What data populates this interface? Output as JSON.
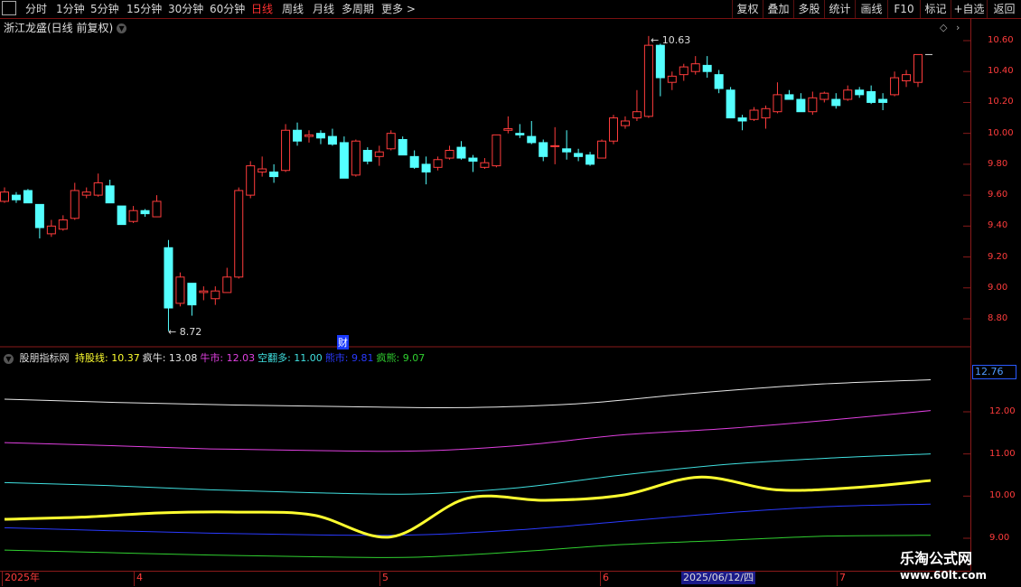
{
  "toolbar": {
    "periods": [
      "分时",
      "1分钟",
      "5分钟",
      "15分钟",
      "30分钟",
      "60分钟",
      "日线",
      "周线",
      "月线",
      "多周期",
      "更多 >"
    ],
    "active_period": "日线",
    "right_buttons": [
      "复权",
      "叠加",
      "多股",
      "统计",
      "画线",
      "F10",
      "标记",
      "+自选",
      "返回"
    ]
  },
  "stock": {
    "title": "浙江龙盛(日线 前复权)"
  },
  "indicator": {
    "name": "股朋指标网",
    "items": [
      {
        "label": "持股线: 10.37",
        "color": "#ffff30"
      },
      {
        "label": "疯牛: 13.08",
        "color": "#e8e8e8"
      },
      {
        "label": "牛市: 12.03",
        "color": "#e040e0"
      },
      {
        "label": "空翻多: 11.00",
        "color": "#40e0e0"
      },
      {
        "label": "熊市: 9.81",
        "color": "#2a3aff"
      },
      {
        "label": "疯熊: 9.07",
        "color": "#30d030"
      }
    ],
    "current_value": "12.76"
  },
  "price_axis": [
    "10.60",
    "10.40",
    "10.20",
    "10.00",
    "9.80",
    "9.60",
    "9.40",
    "9.20",
    "9.00",
    "8.80"
  ],
  "indicator_axis": [
    "12.00",
    "11.00",
    "10.00",
    "9.00"
  ],
  "annotations": {
    "high": "10.63",
    "low": "8.72",
    "marker": "财"
  },
  "x_axis": {
    "labels": [
      "2025年",
      "4",
      "5",
      "6",
      "7"
    ],
    "cursor_date": "2025/06/12/四"
  },
  "watermark": {
    "line1": "乐淘公式网",
    "line2": "www.60lt.com"
  },
  "colors": {
    "up": "#ff3c3c",
    "down": "#54ffff",
    "axis": "#8a1a1a",
    "yellow": "#ffff30"
  },
  "chart_data": {
    "type": "candlestick",
    "ohlc": [
      [
        9.56,
        9.65,
        9.55,
        9.62
      ],
      [
        9.6,
        9.62,
        9.55,
        9.57
      ],
      [
        9.63,
        9.64,
        9.55,
        9.55
      ],
      [
        9.54,
        9.54,
        9.32,
        9.39
      ],
      [
        9.35,
        9.44,
        9.33,
        9.4
      ],
      [
        9.38,
        9.47,
        9.37,
        9.44
      ],
      [
        9.45,
        9.68,
        9.44,
        9.63
      ],
      [
        9.6,
        9.65,
        9.58,
        9.62
      ],
      [
        9.6,
        9.74,
        9.59,
        9.68
      ],
      [
        9.66,
        9.7,
        9.55,
        9.55
      ],
      [
        9.53,
        9.53,
        9.41,
        9.41
      ],
      [
        9.43,
        9.53,
        9.42,
        9.5
      ],
      [
        9.5,
        9.51,
        9.46,
        9.48
      ],
      [
        9.46,
        9.6,
        9.46,
        9.56
      ],
      [
        9.26,
        9.31,
        8.72,
        8.87
      ],
      [
        8.9,
        9.1,
        8.88,
        9.07
      ],
      [
        9.03,
        9.03,
        8.82,
        8.89
      ],
      [
        8.97,
        9.01,
        8.92,
        8.98
      ],
      [
        8.93,
        9.01,
        8.89,
        8.98
      ],
      [
        8.97,
        9.13,
        8.97,
        9.07
      ],
      [
        9.07,
        9.65,
        9.06,
        9.63
      ],
      [
        9.6,
        9.82,
        9.58,
        9.79
      ],
      [
        9.75,
        9.85,
        9.72,
        9.77
      ],
      [
        9.75,
        9.8,
        9.68,
        9.72
      ],
      [
        9.76,
        10.06,
        9.75,
        10.02
      ],
      [
        10.02,
        10.07,
        9.92,
        9.95
      ],
      [
        9.98,
        10.02,
        9.94,
        9.99
      ],
      [
        10.0,
        10.02,
        9.93,
        9.97
      ],
      [
        9.98,
        10.03,
        9.92,
        9.93
      ],
      [
        9.94,
        9.98,
        9.71,
        9.71
      ],
      [
        9.73,
        9.96,
        9.72,
        9.95
      ],
      [
        9.89,
        9.91,
        9.8,
        9.82
      ],
      [
        9.85,
        9.92,
        9.79,
        9.88
      ],
      [
        9.9,
        10.02,
        9.89,
        10.0
      ],
      [
        9.96,
        9.98,
        9.86,
        9.86
      ],
      [
        9.85,
        9.89,
        9.77,
        9.78
      ],
      [
        9.8,
        9.85,
        9.67,
        9.75
      ],
      [
        9.78,
        9.85,
        9.76,
        9.83
      ],
      [
        9.84,
        9.92,
        9.83,
        9.89
      ],
      [
        9.91,
        9.95,
        9.83,
        9.84
      ],
      [
        9.84,
        9.86,
        9.75,
        9.82
      ],
      [
        9.78,
        9.84,
        9.77,
        9.81
      ],
      [
        9.79,
        9.99,
        9.78,
        9.99
      ],
      [
        10.02,
        10.11,
        10.0,
        10.03
      ],
      [
        10.0,
        10.06,
        9.97,
        9.99
      ],
      [
        9.98,
        10.08,
        9.93,
        9.94
      ],
      [
        9.94,
        9.96,
        9.82,
        9.85
      ],
      [
        9.92,
        10.04,
        9.8,
        9.92
      ],
      [
        9.9,
        10.02,
        9.83,
        9.88
      ],
      [
        9.87,
        9.9,
        9.82,
        9.85
      ],
      [
        9.86,
        9.88,
        9.79,
        9.8
      ],
      [
        9.84,
        9.96,
        9.84,
        9.95
      ],
      [
        9.95,
        10.12,
        9.93,
        10.1
      ],
      [
        10.05,
        10.11,
        10.03,
        10.08
      ],
      [
        10.1,
        10.28,
        10.08,
        10.14
      ],
      [
        10.11,
        10.63,
        10.1,
        10.57
      ],
      [
        10.57,
        10.58,
        10.24,
        10.36
      ],
      [
        10.33,
        10.4,
        10.28,
        10.37
      ],
      [
        10.38,
        10.45,
        10.34,
        10.43
      ],
      [
        10.4,
        10.5,
        10.38,
        10.45
      ],
      [
        10.44,
        10.5,
        10.36,
        10.4
      ],
      [
        10.38,
        10.41,
        10.26,
        10.29
      ],
      [
        10.28,
        10.3,
        10.11,
        10.1
      ],
      [
        10.1,
        10.12,
        10.02,
        10.08
      ],
      [
        10.09,
        10.17,
        10.08,
        10.15
      ],
      [
        10.1,
        10.18,
        10.03,
        10.16
      ],
      [
        10.14,
        10.33,
        10.13,
        10.25
      ],
      [
        10.25,
        10.28,
        10.22,
        10.22
      ],
      [
        10.22,
        10.26,
        10.14,
        10.14
      ],
      [
        10.14,
        10.27,
        10.12,
        10.23
      ],
      [
        10.22,
        10.27,
        10.2,
        10.26
      ],
      [
        10.22,
        10.26,
        10.16,
        10.18
      ],
      [
        10.22,
        10.31,
        10.21,
        10.28
      ],
      [
        10.28,
        10.3,
        10.23,
        10.25
      ],
      [
        10.27,
        10.31,
        10.19,
        10.2
      ],
      [
        10.22,
        10.26,
        10.15,
        10.2
      ],
      [
        10.25,
        10.4,
        10.24,
        10.36
      ],
      [
        10.34,
        10.41,
        10.3,
        10.38
      ],
      [
        10.33,
        10.51,
        10.3,
        10.51
      ]
    ],
    "indicator_series": [
      {
        "name": "疯牛",
        "color": "#e8e8e8",
        "values": [
          12.3,
          12.22,
          12.16,
          12.12,
          12.1,
          12.2,
          12.45,
          12.65,
          12.76
        ]
      },
      {
        "name": "牛市",
        "color": "#e040e0",
        "values": [
          11.27,
          11.2,
          11.12,
          11.08,
          11.07,
          11.2,
          11.45,
          11.6,
          11.8,
          12.03
        ]
      },
      {
        "name": "空翻多",
        "color": "#40e0e0",
        "values": [
          10.32,
          10.25,
          10.15,
          10.08,
          10.05,
          10.2,
          10.5,
          10.75,
          10.9,
          11.0
        ]
      },
      {
        "name": "熊市",
        "color": "#2a3aff",
        "values": [
          9.25,
          9.18,
          9.12,
          9.08,
          9.08,
          9.2,
          9.4,
          9.6,
          9.75,
          9.81
        ]
      },
      {
        "name": "疯熊",
        "color": "#30d030",
        "values": [
          8.72,
          8.66,
          8.6,
          8.56,
          8.55,
          8.68,
          8.85,
          8.95,
          9.05,
          9.07
        ]
      },
      {
        "name": "持股线",
        "color": "#ffff30",
        "values": [
          9.45,
          9.5,
          9.6,
          9.62,
          9.55,
          9.03,
          9.95,
          9.9,
          10.02,
          10.45,
          10.15,
          10.2,
          10.37
        ]
      }
    ]
  }
}
